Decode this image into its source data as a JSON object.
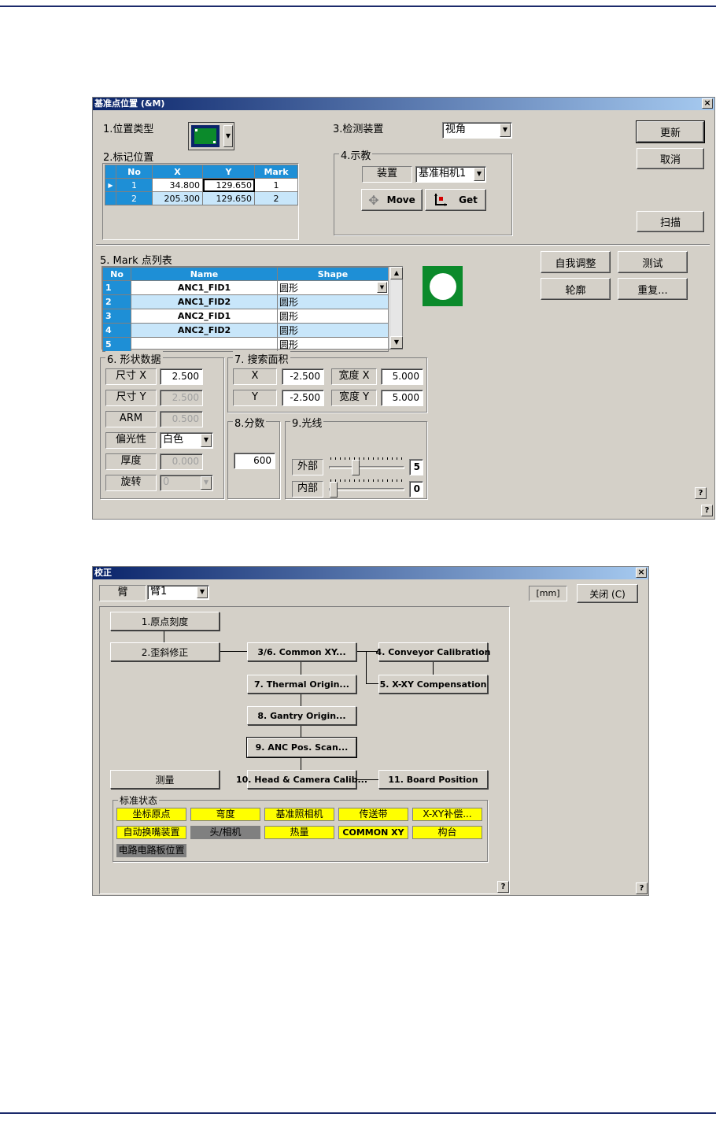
{
  "dlg1": {
    "title": "基准点位置 (&M)",
    "pos_type_label": "1.位置类型",
    "mark_pos_label": "2.标记位置",
    "detect_label": "3.检测装置",
    "detect_value": "视角",
    "teach_label": "4.示教",
    "device_label": "装置",
    "device_value": "基准相机1",
    "move_label": "Move",
    "get_label": "Get",
    "update_btn": "更新",
    "cancel_btn": "取消",
    "scan_btn": "扫描",
    "mark_table": {
      "headers": [
        "No",
        "X",
        "Y",
        "Mark"
      ],
      "rows": [
        [
          "1",
          "34.800",
          "129.650",
          "1"
        ],
        [
          "2",
          "205.300",
          "129.650",
          "2"
        ]
      ]
    },
    "mark_list_label": "5. Mark 点列表",
    "list_table": {
      "headers": [
        "No",
        "Name",
        "Shape"
      ],
      "rows": [
        [
          "1",
          "ANC1_FID1",
          "圆形"
        ],
        [
          "2",
          "ANC1_FID2",
          "圆形"
        ],
        [
          "3",
          "ANC2_FID1",
          "圆形"
        ],
        [
          "4",
          "ANC2_FID2",
          "圆形"
        ],
        [
          "5",
          "",
          "圆形"
        ]
      ]
    },
    "self_adjust_btn": "自我调整",
    "test_btn": "测试",
    "contour_btn": "轮廓",
    "repeat_btn": "重复...",
    "shape_label": "6. 形状数据",
    "size_x_label": "尺寸 X",
    "size_x": "2.500",
    "size_y_label": "尺寸 Y",
    "size_y": "2.500",
    "arm_label": "ARM",
    "arm": "0.500",
    "polarity_label": "偏光性",
    "polarity": "白色",
    "thickness_label": "厚度",
    "thickness": "0.000",
    "rotation_label": "旋转",
    "rotation": "0",
    "search_label": "7. 搜索面积",
    "x_label": "X",
    "x": "-2.500",
    "y_label": "Y",
    "y": "-2.500",
    "width_x_label": "宽度 X",
    "width_x": "5.000",
    "width_y_label": "宽度 Y",
    "width_y": "5.000",
    "score_label": "8.分数",
    "score": "600",
    "light_label": "9.光线",
    "outer_label": "外部",
    "outer": "5",
    "inner_label": "内部",
    "inner": "0",
    "help": "?"
  },
  "dlg2": {
    "title": "校正",
    "arm_label": "臂",
    "arm_value": "臂1",
    "unit": "[mm]",
    "close_btn": "关闭 (C)",
    "flow": {
      "b1": "1.原点刻度",
      "b2": "2.歪斜修正",
      "b3": "3/6. Common XY...",
      "b4": "4. Conveyor Calibration",
      "b5": "5. X-XY Compensation",
      "b7": "7. Thermal Origin...",
      "b8": "8. Gantry Origin...",
      "b9": "9. ANC Pos. Scan...",
      "b10": "10. Head & Camera Calib...",
      "b11": "11. Board Position",
      "measure": "测量"
    },
    "status_label": "标准状态",
    "status": [
      {
        "text": "坐标原点",
        "color": "#ffff00"
      },
      {
        "text": "弯度",
        "color": "#ffff00"
      },
      {
        "text": "基准照相机",
        "color": "#ffff00"
      },
      {
        "text": "传送带",
        "color": "#ffff00"
      },
      {
        "text": "X-XY补偿...",
        "color": "#ffff00"
      },
      {
        "text": "自动换嘴装置",
        "color": "#ffff00"
      },
      {
        "text": "头/相机",
        "color": "#808080"
      },
      {
        "text": "热量",
        "color": "#ffff00"
      },
      {
        "text": "COMMON XY",
        "color": "#ffff00"
      },
      {
        "text": "构台",
        "color": "#ffff00"
      },
      {
        "text": "电路电路板位置",
        "color": "#808080"
      }
    ],
    "help": "?"
  }
}
